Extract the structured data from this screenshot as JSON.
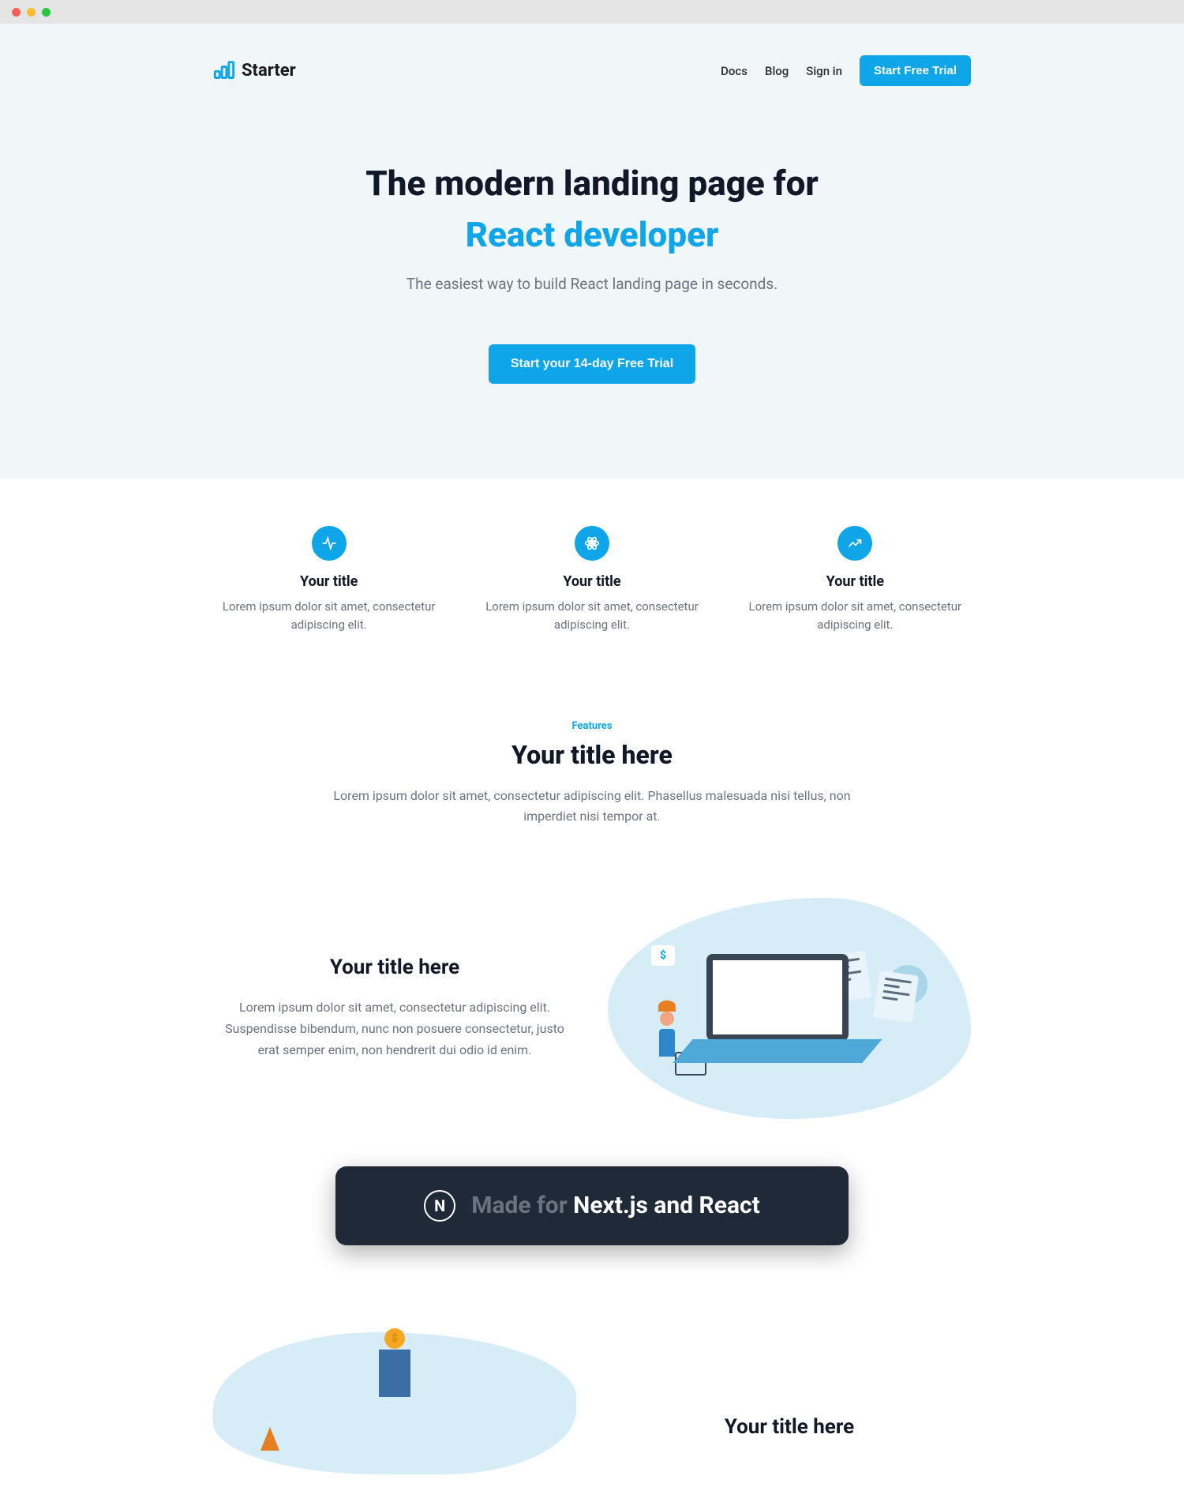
{
  "brand": {
    "name": "Starter"
  },
  "nav": {
    "links": [
      "Docs",
      "Blog",
      "Sign in"
    ],
    "cta": "Start Free Trial"
  },
  "hero": {
    "title_line1": "The modern landing page for",
    "title_line2": "React developer",
    "subtitle": "The easiest way to build React landing page in seconds.",
    "cta": "Start your 14-day Free Trial"
  },
  "features": [
    {
      "title": "Your title",
      "desc": "Lorem ipsum dolor sit amet, consectetur adipiscing elit."
    },
    {
      "title": "Your title",
      "desc": "Lorem ipsum dolor sit amet, consectetur adipiscing elit."
    },
    {
      "title": "Your title",
      "desc": "Lorem ipsum dolor sit amet, consectetur adipiscing elit."
    }
  ],
  "section": {
    "eyebrow": "Features",
    "title": "Your title here",
    "subtitle": "Lorem ipsum dolor sit amet, consectetur adipiscing elit. Phasellus malesuada nisi tellus, non imperdiet nisi tempor at."
  },
  "feature_block": {
    "title": "Your title here",
    "desc": "Lorem ipsum dolor sit amet, consectetur adipiscing elit. Suspendisse bibendum, nunc non posuere consectetur, justo erat semper enim, non hendrerit dui odio id enim."
  },
  "banner": {
    "icon_letter": "N",
    "prefix": "Made for ",
    "highlight": "Next.js and React"
  },
  "next_section": {
    "title": "Your title here"
  },
  "price_symbol": "$",
  "coin_symbol": "$"
}
